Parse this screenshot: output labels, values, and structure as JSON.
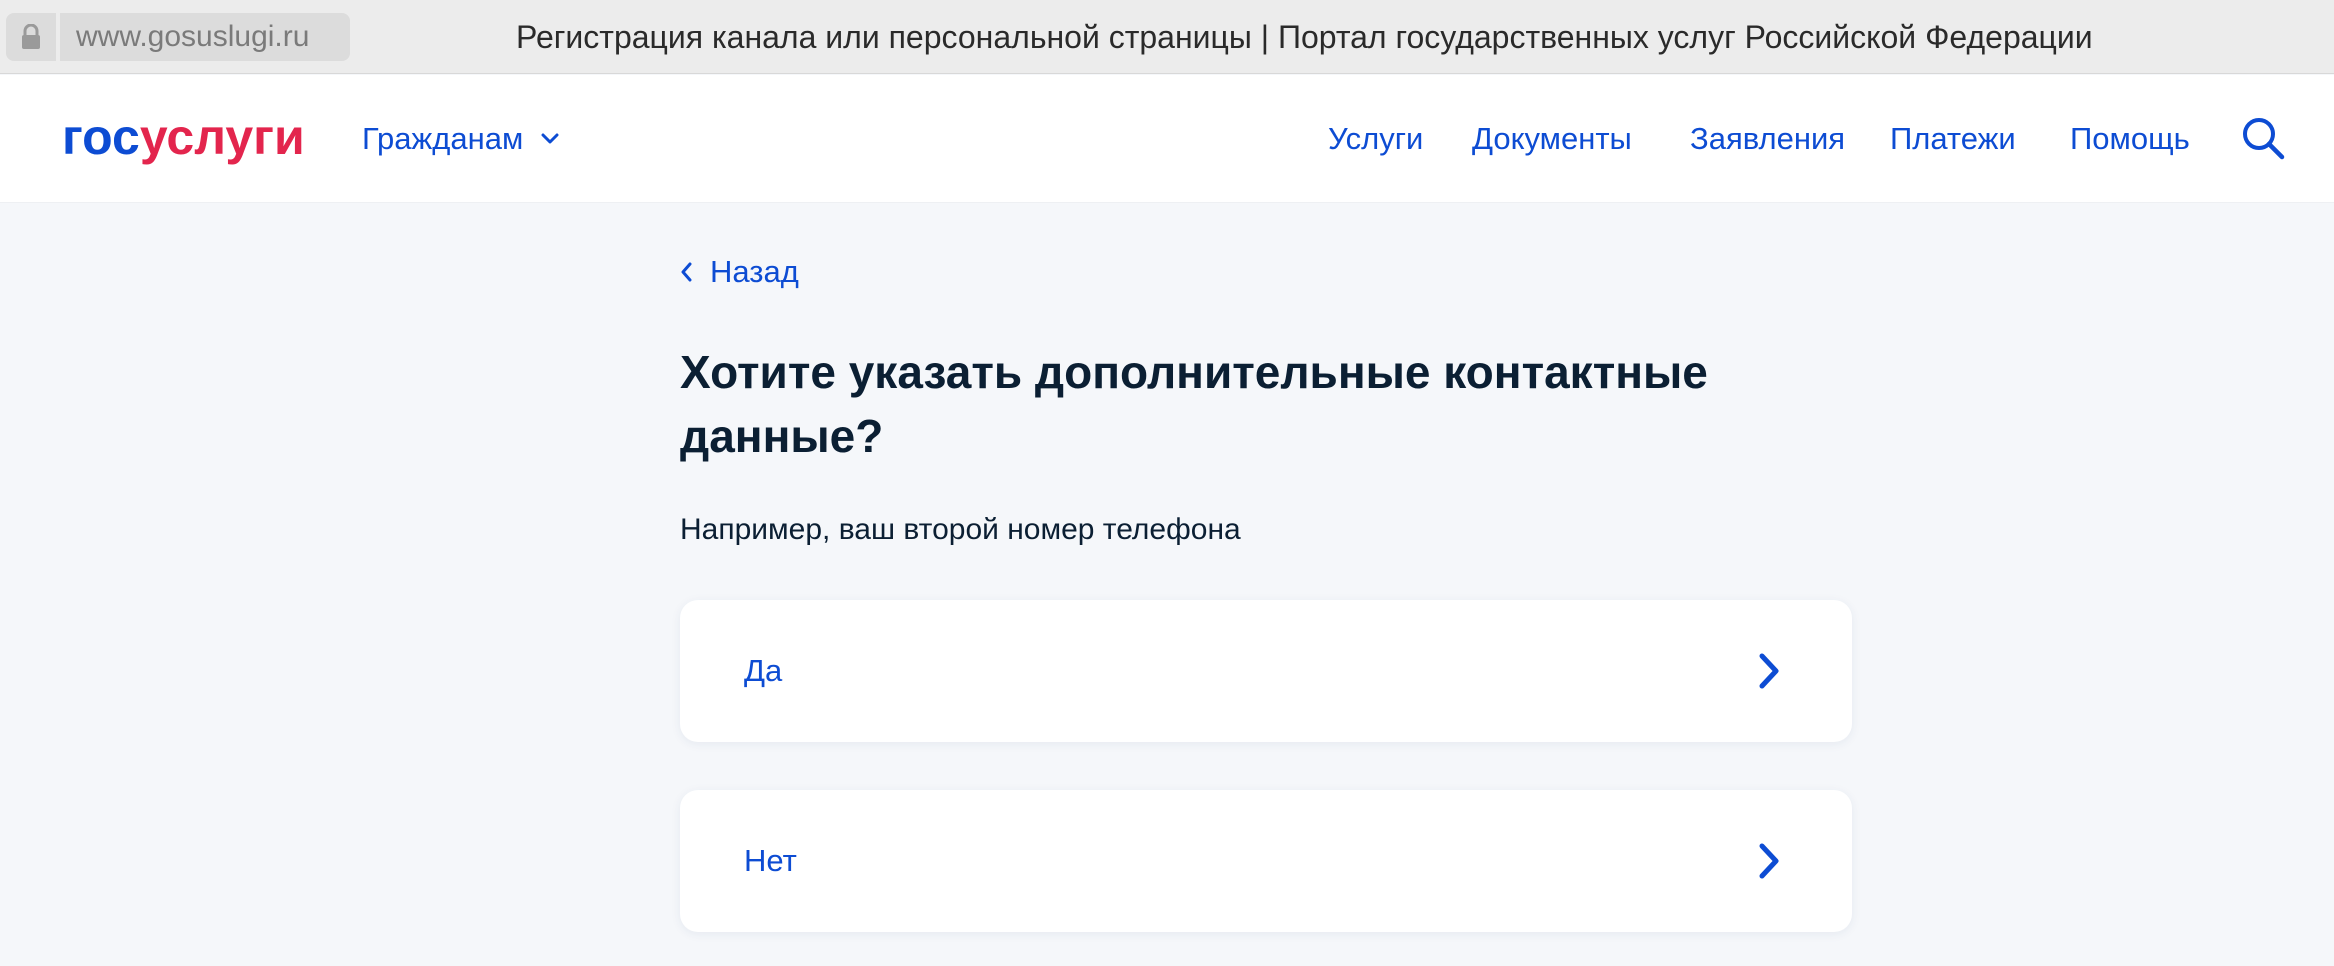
{
  "browser": {
    "url": "www.gosuslugi.ru",
    "tab_title": "Регистрация канала или персональной страницы | Портал государственных услуг Российской Федерации"
  },
  "header": {
    "logo": {
      "part1": "гос",
      "part2": "услуги"
    },
    "audience_menu": "Гражданам",
    "nav": [
      "Услуги",
      "Документы",
      "Заявления",
      "Платежи",
      "Помощь"
    ]
  },
  "main": {
    "back_label": "Назад",
    "title": "Хотите указать дополнительные контактные данные?",
    "subtitle": "Например, ваш второй номер телефона",
    "options": [
      {
        "label": "Да"
      },
      {
        "label": "Нет"
      }
    ]
  },
  "colors": {
    "accent": "#0d4cd3",
    "logo_red": "#e3254d",
    "text_dark": "#0b1f33",
    "page_bg": "#f5f7fa"
  },
  "icons": {
    "lock": "lock-icon",
    "dropdown": "chevron-down-icon",
    "search": "search-icon",
    "back": "chevron-left-icon",
    "option_arrow": "chevron-right-icon"
  }
}
